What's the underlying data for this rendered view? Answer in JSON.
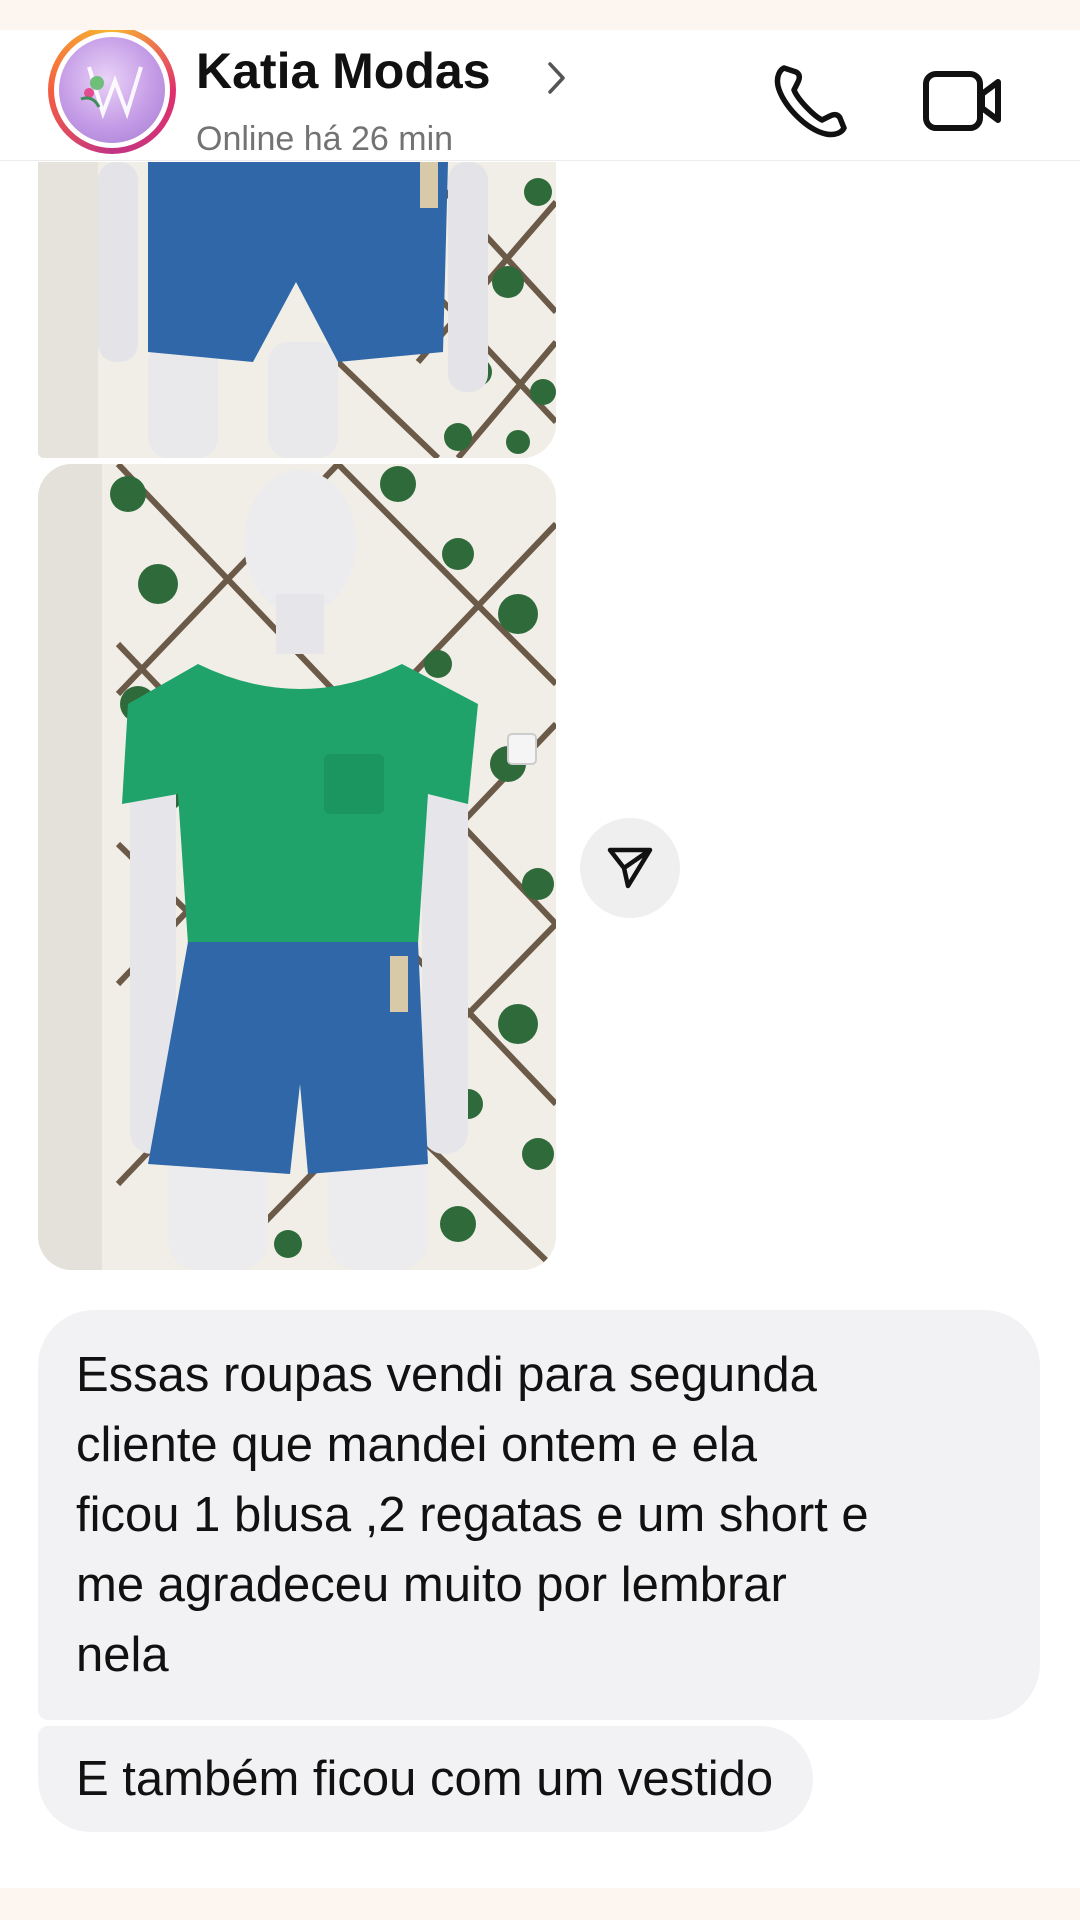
{
  "header": {
    "contact_name": "Katia Modas",
    "status": "Online há 26 min",
    "icons": {
      "avatar": "store-logo-avatar",
      "chevron": "chevron-right-icon",
      "call": "phone-icon",
      "video": "video-camera-icon"
    }
  },
  "messages": [
    {
      "type": "image",
      "description_icon": "photo-mannequin-denim-shorts"
    },
    {
      "type": "image",
      "description_icon": "photo-mannequin-green-tshirt-denim-shorts"
    },
    {
      "type": "text",
      "lines": [
        "Essas roupas vendi para segunda",
        "cliente que mandei ontem e ela",
        "ficou 1 blusa ,2 regatas e um short e",
        "me agradeceu muito por lembrar",
        "nela"
      ]
    },
    {
      "type": "text",
      "lines": [
        "E também ficou com um vestido"
      ]
    }
  ],
  "share_icon": "paper-plane-icon",
  "colors": {
    "bubble_bg": "#f2f2f4",
    "shirt_green": "#1fa36b",
    "denim_blue": "#2f67a8",
    "status_gray": "#737373"
  }
}
